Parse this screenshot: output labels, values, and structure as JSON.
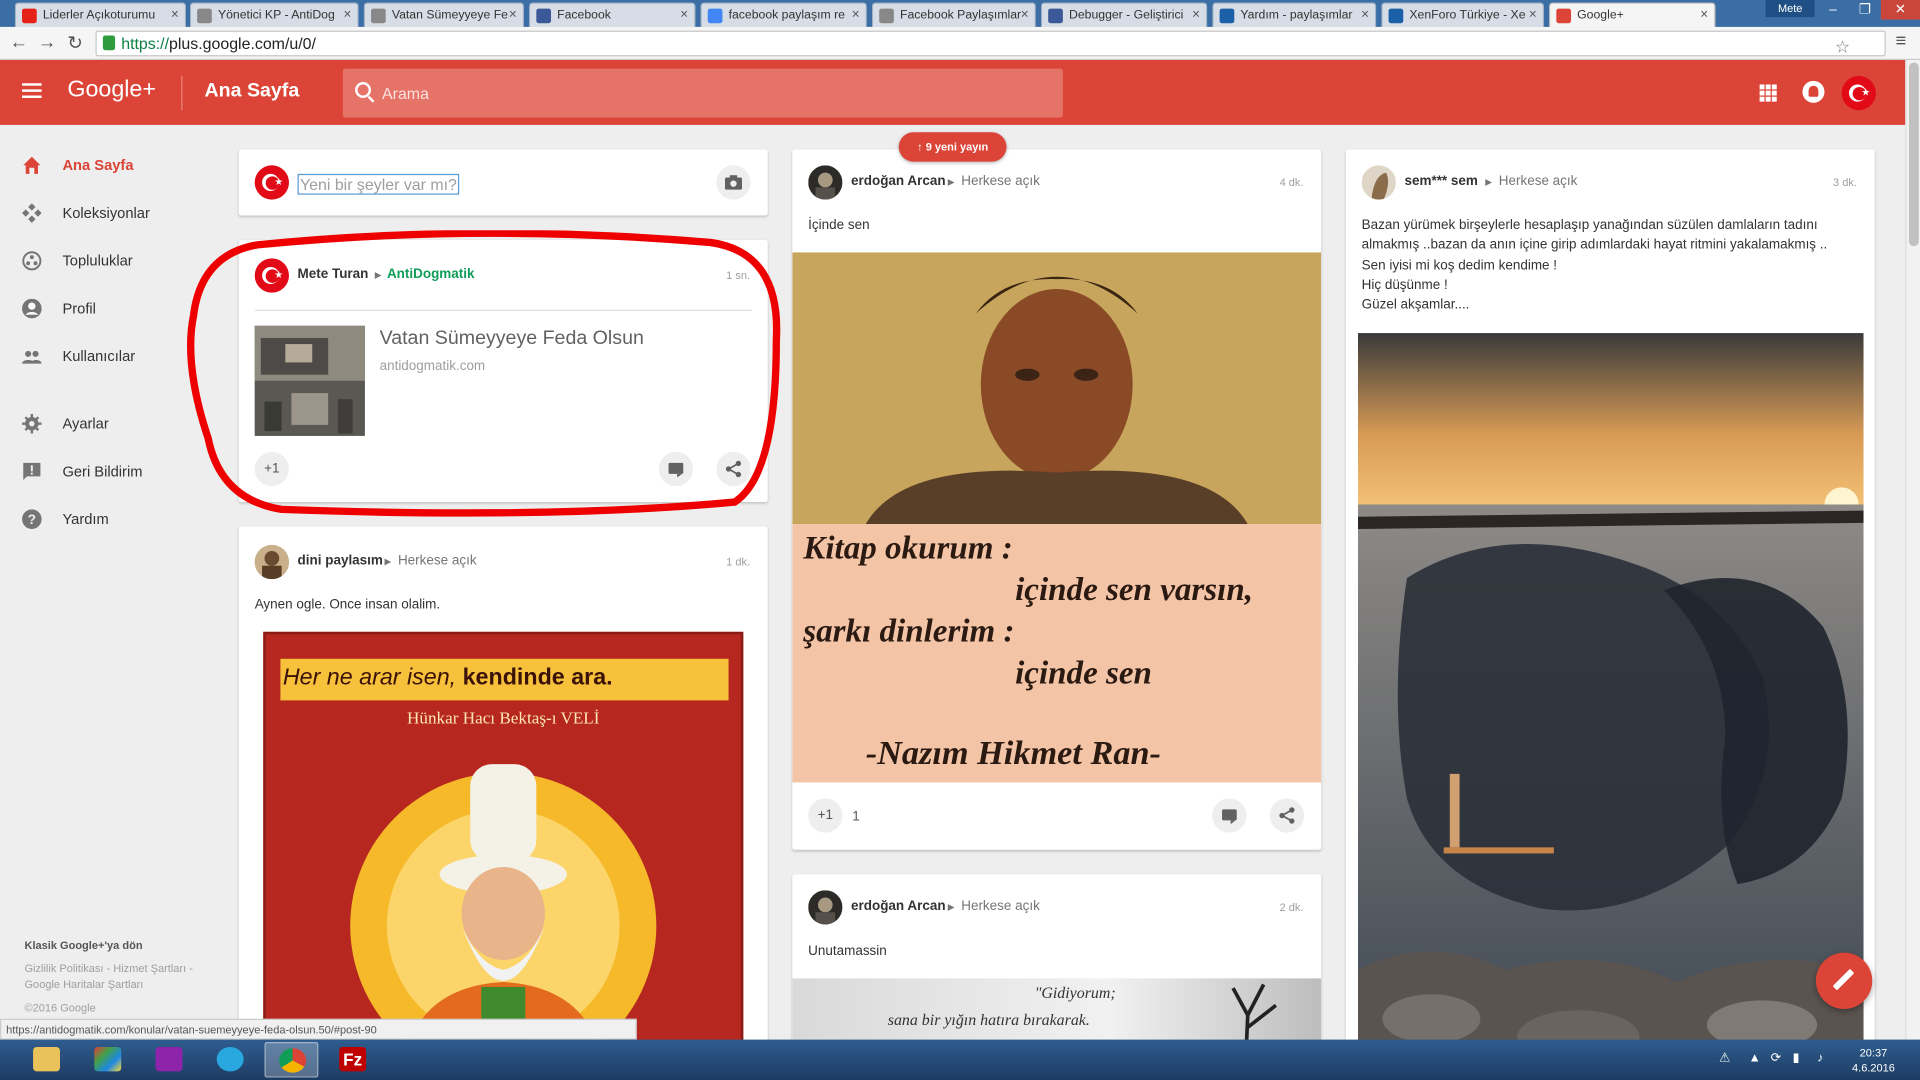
{
  "browser": {
    "tabs": [
      {
        "label": "Liderler Açıkoturumu",
        "icon": "youtube-icon",
        "color": "#e62117"
      },
      {
        "label": "Yönetici KP - AntiDog",
        "icon": "page-icon",
        "color": "#888888"
      },
      {
        "label": "Vatan Sümeyyeye Fe",
        "icon": "page-icon",
        "color": "#888888"
      },
      {
        "label": "Facebook",
        "icon": "facebook-icon",
        "color": "#3b5998"
      },
      {
        "label": "facebook paylaşım re",
        "icon": "google-icon",
        "color": "#4285f4"
      },
      {
        "label": "Facebook Paylaşımlar",
        "icon": "page-icon",
        "color": "#888888"
      },
      {
        "label": "Debugger - Geliştirici",
        "icon": "facebook-icon",
        "color": "#3b5998"
      },
      {
        "label": "Yardım - paylaşımlar",
        "icon": "xenforo-icon",
        "color": "#1b5fa8"
      },
      {
        "label": "XenForo Türkiye - Xe",
        "icon": "xenforo-icon",
        "color": "#1b5fa8"
      },
      {
        "label": "Google+",
        "icon": "gplus-icon",
        "color": "#db4437"
      }
    ],
    "user": "Mete",
    "url_scheme": "https://",
    "url_rest": "plus.google.com/u/0/",
    "status_url": "https://antidogmatik.com/konular/vatan-suemeyyeye-feda-olsun.50/#post-90"
  },
  "header": {
    "logo": "Google+",
    "title": "Ana Sayfa",
    "search_placeholder": "Arama",
    "accent": "#db4437"
  },
  "sidebar": {
    "items": [
      {
        "label": "Ana Sayfa",
        "icon": "home-icon",
        "active": true
      },
      {
        "label": "Koleksiyonlar",
        "icon": "collections-icon",
        "active": false
      },
      {
        "label": "Topluluklar",
        "icon": "communities-icon",
        "active": false
      },
      {
        "label": "Profil",
        "icon": "profile-icon",
        "active": false
      },
      {
        "label": "Kullanıcılar",
        "icon": "people-icon",
        "active": false
      },
      {
        "label": "Ayarlar",
        "icon": "settings-icon",
        "active": false
      },
      {
        "label": "Geri Bildirim",
        "icon": "feedback-icon",
        "active": false
      },
      {
        "label": "Yardım",
        "icon": "help-icon",
        "active": false
      }
    ],
    "footer": {
      "classic": "Klasik Google+'ya dön",
      "links1": "Gizlilik Politikası - Hizmet Şartları -",
      "links2": "Google Haritalar Şartları",
      "copyright": "©2016 Google"
    }
  },
  "feed": {
    "new_posts_label": "9 yeni yayın",
    "composer_placeholder": "Yeni bir şeyler var mı?",
    "plus_one_label": "+1",
    "posts": {
      "mete": {
        "author": "Mete Turan",
        "community": "AntiDogmatik",
        "time": "1 sn.",
        "link_title": "Vatan Sümeyyeye Feda Olsun",
        "link_domain": "antidogmatik.com"
      },
      "dini": {
        "author": "dini paylasım",
        "visibility": "Herkese açık",
        "time": "1 dk.",
        "text": "Aynen ogle.  Once insan olalim.",
        "img_line1a": "Her ne arar isen, ",
        "img_line1b": "kendinde ara.",
        "img_line2": "Hünkar Hacı Bektaş-ı VELİ"
      },
      "erdogan1": {
        "author": "erdoğan Arcan",
        "visibility": "Herkese açık",
        "time": "4 dk.",
        "text": "İçinde  sen",
        "poem1": "Kitap okurum :",
        "poem2": "içinde sen varsın,",
        "poem3": "şarkı dinlerim :",
        "poem4": "içinde sen",
        "poem5": "-Nazım Hikmet Ran-",
        "plus_count": "1"
      },
      "erdogan2": {
        "author": "erdoğan Arcan",
        "visibility": "Herkese açık",
        "time": "2 dk.",
        "text": "Unutamassin",
        "img_line1": "\"Gidiyorum;",
        "img_line2": "sana bir yığın hatıra bırakarak."
      },
      "sem": {
        "author": "sem*** sem",
        "visibility": "Herkese açık",
        "time": "3 dk.",
        "text1": "Bazan yürümek birşeylerle hesaplaşıp yanağından süzülen damlaların tadını",
        "text2": "almakmış ..bazan da anın içine girip adımlardaki hayat ritmini yakalamakmış ..",
        "text3": "Sen iyisi mi koş dedim kendime !",
        "text4": "Hiç düşünme !",
        "text5": "Güzel akşamlar...."
      }
    }
  },
  "taskbar": {
    "time": "20:37",
    "date": "4.6.2016"
  }
}
